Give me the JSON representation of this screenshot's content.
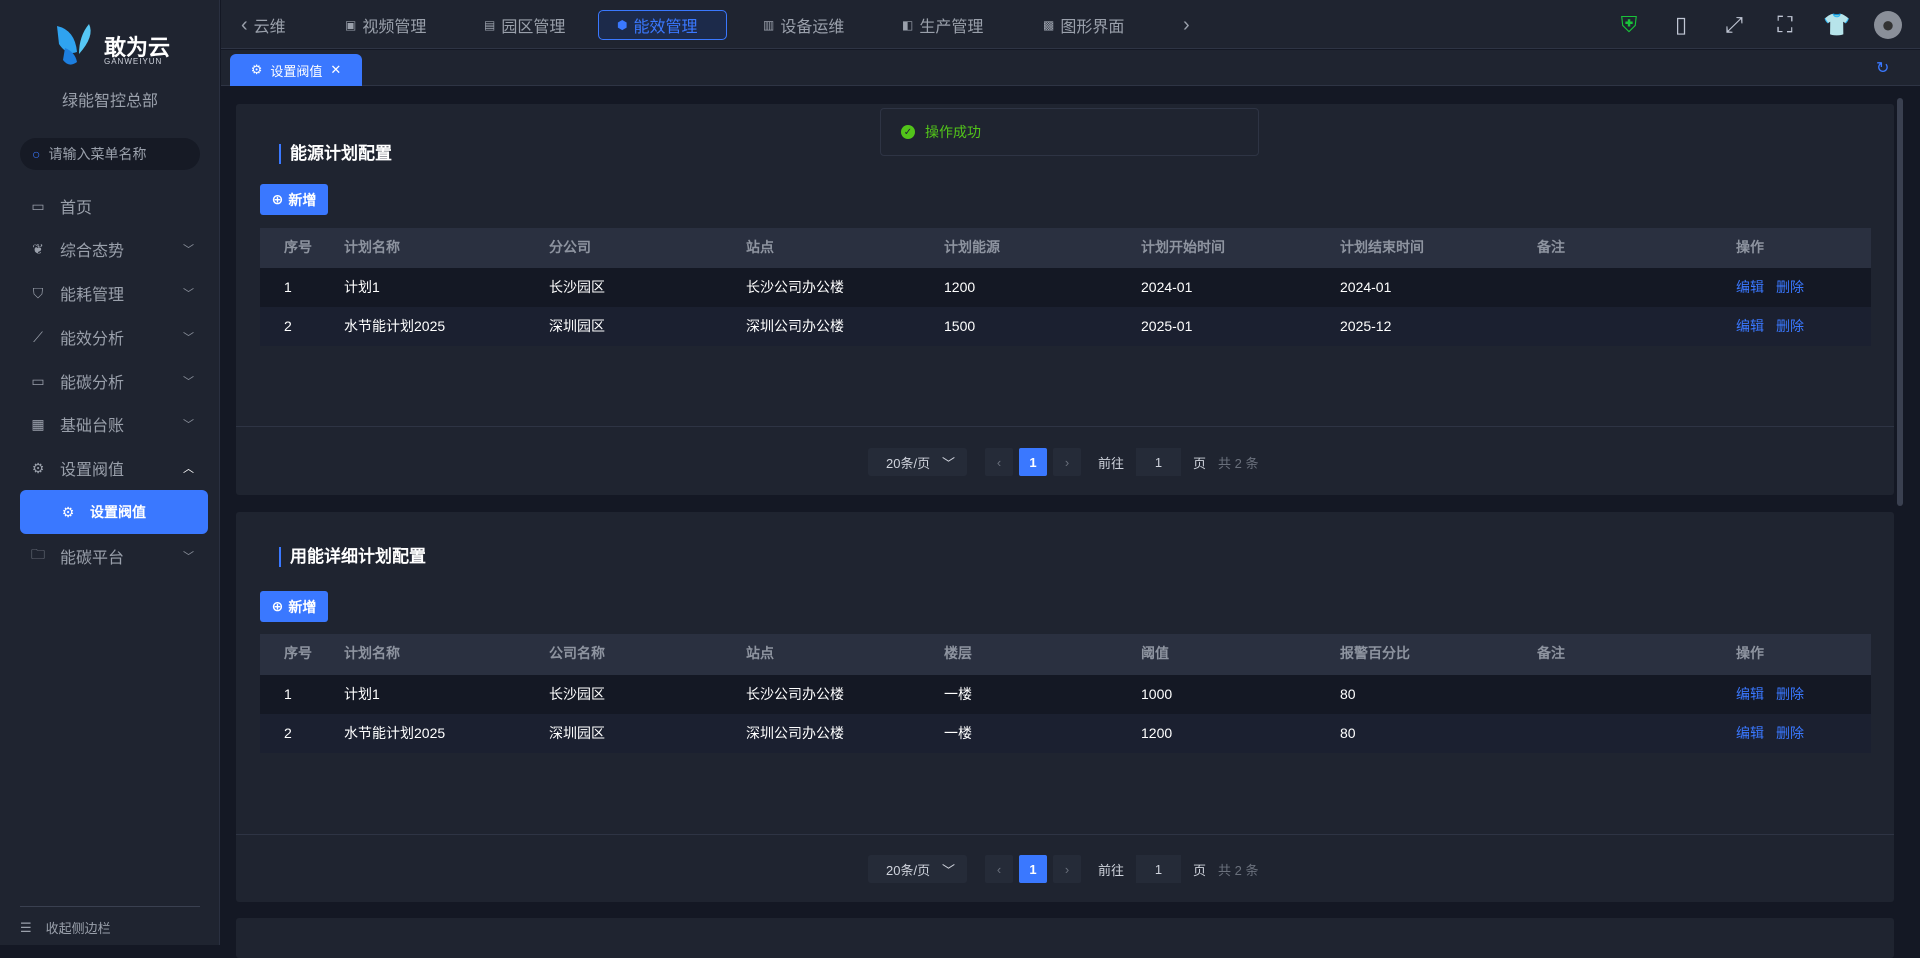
{
  "brand": {
    "name": "敢为云",
    "sub": "GANWEIYUN",
    "org": "绿能智控总部"
  },
  "sidebar": {
    "search_placeholder": "请输入菜单名称",
    "items": [
      {
        "label": "首页",
        "icon": "monitor-icon"
      },
      {
        "label": "综合态势",
        "icon": "leaf-icon"
      },
      {
        "label": "能耗管理",
        "icon": "shield-drop-icon"
      },
      {
        "label": "能效分析",
        "icon": "line-chart-icon"
      },
      {
        "label": "能碳分析",
        "icon": "monitor-icon"
      },
      {
        "label": "基础台账",
        "icon": "grid-icon"
      },
      {
        "label": "设置阀值",
        "icon": "gear-icon"
      },
      {
        "label": "设置阀值",
        "icon": "gear-icon"
      },
      {
        "label": "能碳平台",
        "icon": "folder-icon"
      }
    ],
    "collapse": "收起侧边栏"
  },
  "topnav": {
    "back": "云维",
    "items": [
      "视频管理",
      "园区管理",
      "能效管理",
      "设备运维",
      "生产管理",
      "图形界面"
    ],
    "active": "能效管理"
  },
  "tabs": [
    {
      "label": "设置阀值"
    }
  ],
  "toast": {
    "text": "操作成功",
    "color": "#52c41a"
  },
  "panel1": {
    "title": "能源计划配置",
    "add": "新增",
    "columns": [
      "序号",
      "计划名称",
      "分公司",
      "站点",
      "计划能源",
      "计划开始时间",
      "计划结束时间",
      "备注",
      "操作"
    ],
    "rows": [
      [
        "1",
        "计划1",
        "长沙园区",
        "长沙公司办公楼",
        "1200",
        "2024-01",
        "2024-01",
        ""
      ],
      [
        "2",
        "水节能计划2025",
        "深圳园区",
        "深圳公司办公楼",
        "1500",
        "2025-01",
        "2025-12",
        ""
      ]
    ],
    "actions": [
      "编辑",
      "删除"
    ],
    "pagination": {
      "page_size": "20条/页",
      "current": "1",
      "goto": "前往",
      "goto_value": "1",
      "page_unit": "页",
      "total": "共 2 条"
    }
  },
  "panel2": {
    "title": "用能详细计划配置",
    "add": "新增",
    "columns": [
      "序号",
      "计划名称",
      "公司名称",
      "站点",
      "楼层",
      "阈值",
      "报警百分比",
      "备注",
      "操作"
    ],
    "rows": [
      [
        "1",
        "计划1",
        "长沙园区",
        "长沙公司办公楼",
        "一楼",
        "1000",
        "80",
        ""
      ],
      [
        "2",
        "水节能计划2025",
        "深圳园区",
        "深圳公司办公楼",
        "一楼",
        "1200",
        "80",
        ""
      ]
    ],
    "actions": [
      "编辑",
      "删除"
    ],
    "pagination": {
      "page_size": "20条/页",
      "current": "1",
      "goto": "前往",
      "goto_value": "1",
      "page_unit": "页",
      "total": "共 2 条"
    }
  },
  "colors": {
    "accent": "#3a78ff",
    "bg": "#141824",
    "panel": "#1f2430"
  }
}
